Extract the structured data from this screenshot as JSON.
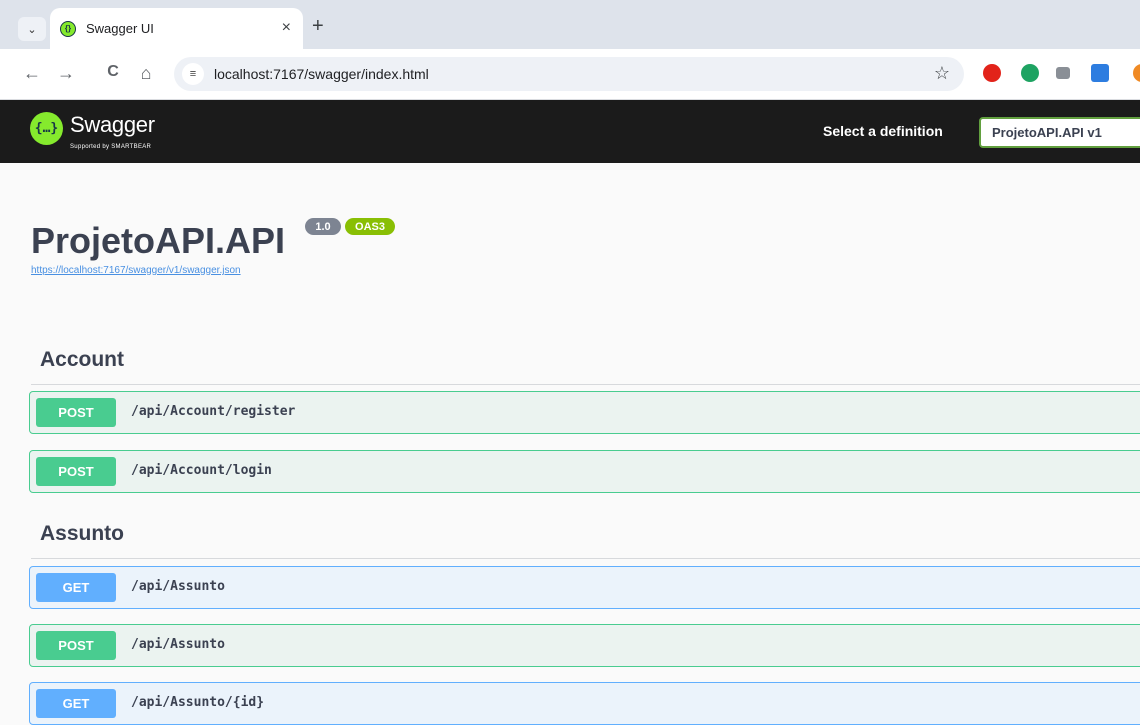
{
  "browser": {
    "tab_title": "Swagger UI",
    "tab_close": "×",
    "new_tab": "+",
    "url": "localhost:7167/swagger/index.html",
    "back_icon": "←",
    "forward_icon": "→",
    "reload_icon": "C",
    "home_icon": "⌂",
    "star_icon": "☆",
    "dropdown_icon": "⌄"
  },
  "topbar": {
    "logo_text": "Swagger",
    "logo_sub": "Supported by SMARTBEAR",
    "select_label": "Select a definition",
    "selected_definition": "ProjetoAPI.API v1"
  },
  "info": {
    "title": "ProjetoAPI.API",
    "version": "1.0",
    "oas": "OAS3",
    "spec_url": "https://localhost:7167/swagger/v1/swagger.json"
  },
  "sections": [
    {
      "name": "Account",
      "operations": [
        {
          "method": "POST",
          "path": "/api/Account/register"
        },
        {
          "method": "POST",
          "path": "/api/Account/login"
        }
      ]
    },
    {
      "name": "Assunto",
      "operations": [
        {
          "method": "GET",
          "path": "/api/Assunto"
        },
        {
          "method": "POST",
          "path": "/api/Assunto"
        },
        {
          "method": "GET",
          "path": "/api/Assunto/{id}"
        }
      ]
    }
  ],
  "colors": {
    "post": "#49cc90",
    "get": "#61affe",
    "topbar": "#1b1b1b",
    "logo": "#85ea2d"
  }
}
